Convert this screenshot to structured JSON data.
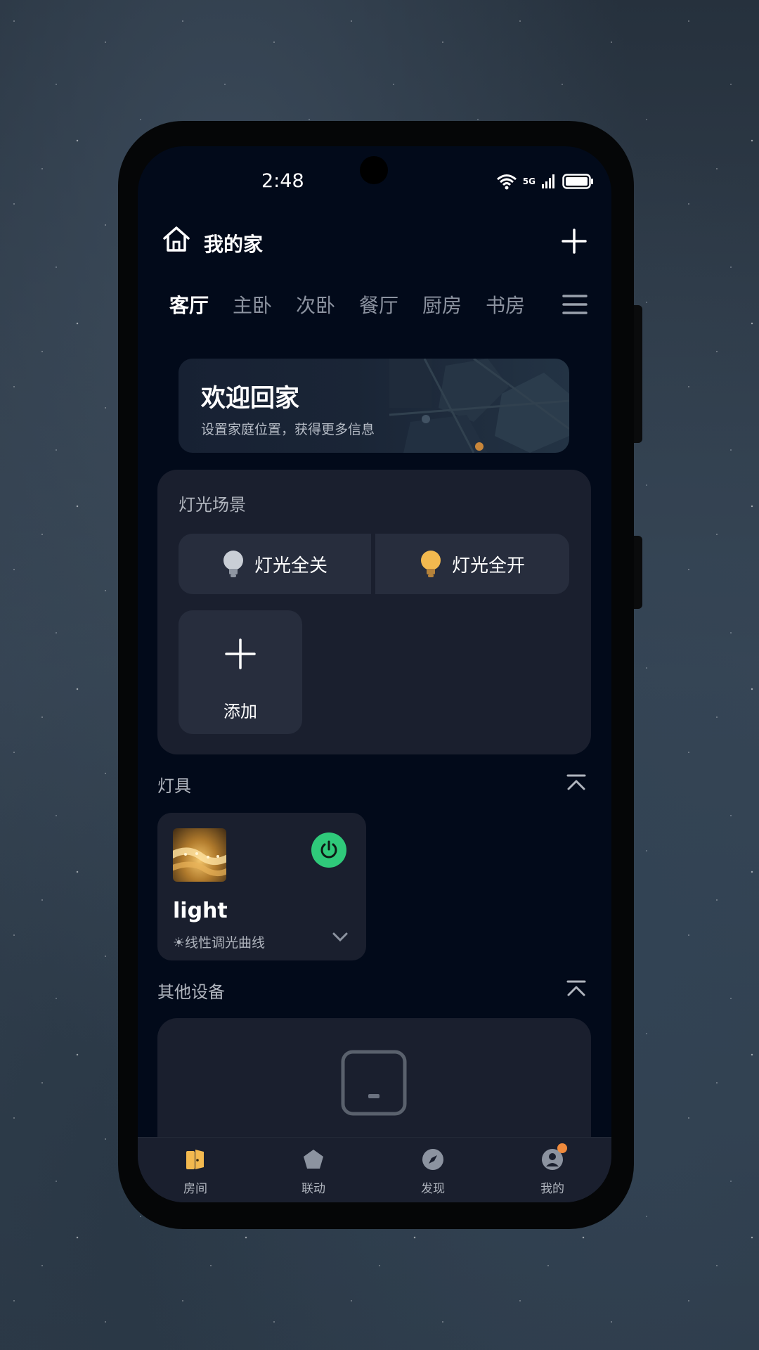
{
  "status": {
    "time": "2:48",
    "network": "5G"
  },
  "header": {
    "title": "我的家"
  },
  "tabs": [
    {
      "label": "客厅",
      "active": true
    },
    {
      "label": "主卧",
      "active": false
    },
    {
      "label": "次卧",
      "active": false
    },
    {
      "label": "餐厅",
      "active": false
    },
    {
      "label": "厨房",
      "active": false
    },
    {
      "label": "书房",
      "active": false
    }
  ],
  "welcome": {
    "title": "欢迎回家",
    "subtitle": "设置家庭位置，获得更多信息"
  },
  "scenes": {
    "title": "灯光场景",
    "off_label": "灯光全关",
    "on_label": "灯光全开",
    "add_label": "添加"
  },
  "lights": {
    "title": "灯具",
    "devices": [
      {
        "name": "light",
        "subtitle": "线性调光曲线",
        "power": "on"
      }
    ]
  },
  "other": {
    "title": "其他设备"
  },
  "nav": [
    {
      "label": "房间",
      "icon": "room-icon",
      "active": true
    },
    {
      "label": "联动",
      "icon": "pentagon-icon",
      "active": false
    },
    {
      "label": "发现",
      "icon": "compass-icon",
      "active": false
    },
    {
      "label": "我的",
      "icon": "profile-icon",
      "active": false,
      "badge": true
    }
  ],
  "colors": {
    "accent": "#f3b94f",
    "power_on": "#2fc97a",
    "badge": "#f08a3c"
  }
}
